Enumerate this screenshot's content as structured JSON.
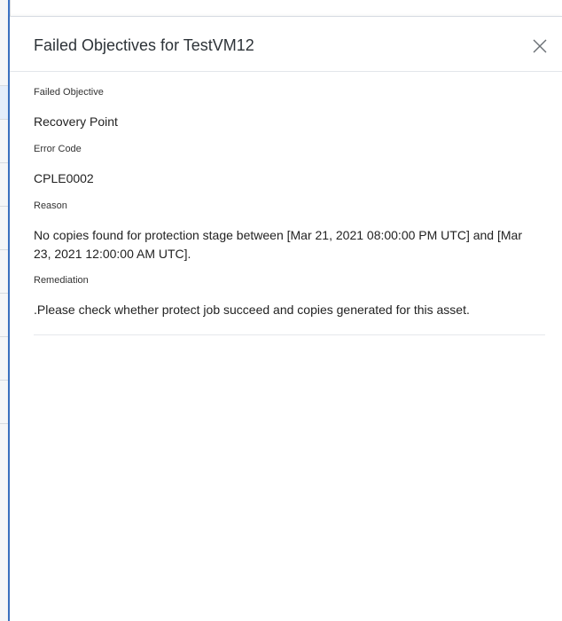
{
  "dialog": {
    "title": "Failed Objectives for TestVM12",
    "close_icon": "close-icon"
  },
  "fields": {
    "failed_objective": {
      "label": "Failed Objective",
      "value": "Recovery Point"
    },
    "error_code": {
      "label": "Error Code",
      "value": "CPLE0002"
    },
    "reason": {
      "label": "Reason",
      "value": "No copies found for protection stage between [Mar 21, 2021 08:00:00 PM UTC] and [Mar 23, 2021 12:00:00 AM UTC]."
    },
    "remediation": {
      "label": "Remediation",
      "value": ".Please check whether protect job succeed and copies generated for this asset."
    }
  },
  "colors": {
    "accent_border": "#3b73c6",
    "title_text": "#2d3338",
    "divider": "#e6e8eb"
  }
}
